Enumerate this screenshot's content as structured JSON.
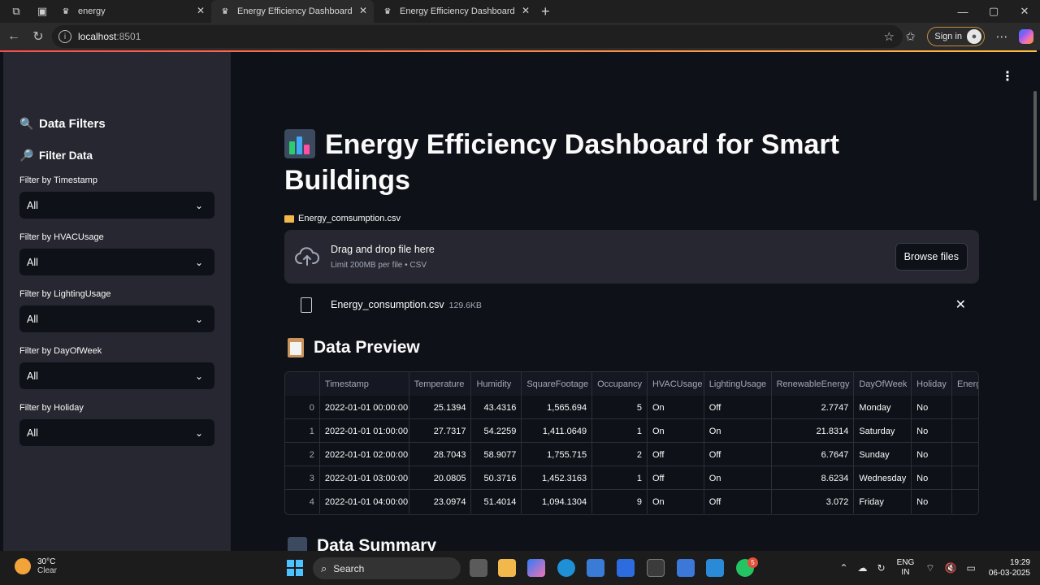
{
  "browser": {
    "tabs": [
      {
        "label": "energy",
        "active": false
      },
      {
        "label": "Energy Efficiency Dashboard",
        "active": true
      },
      {
        "label": "Energy Efficiency Dashboard",
        "active": false
      }
    ],
    "url_host": "localhost",
    "url_port": ":8501",
    "sign_in_label": "Sign in"
  },
  "sidebar": {
    "title": "Data Filters",
    "subtitle": "Filter Data",
    "filters": [
      {
        "label": "Filter by Timestamp",
        "value": "All"
      },
      {
        "label": "Filter by HVACUsage",
        "value": "All"
      },
      {
        "label": "Filter by LightingUsage",
        "value": "All"
      },
      {
        "label": "Filter by DayOfWeek",
        "value": "All"
      },
      {
        "label": "Filter by Holiday",
        "value": "All"
      }
    ]
  },
  "main": {
    "title": "Energy Efficiency Dashboard for Smart Buildings",
    "uploader_label": "Energy_comsumption.csv",
    "dropzone_title": "Drag and drop file here",
    "dropzone_limit": "Limit 200MB per file • CSV",
    "browse_label": "Browse files",
    "uploaded_file": {
      "name": "Energy_consumption.csv",
      "size": "129.6KB"
    },
    "preview_heading": "Data Preview",
    "summary_heading": "Data Summary",
    "table": {
      "columns": [
        "",
        "Timestamp",
        "Temperature",
        "Humidity",
        "SquareFootage",
        "Occupancy",
        "HVACUsage",
        "LightingUsage",
        "RenewableEnergy",
        "DayOfWeek",
        "Holiday",
        "Energ"
      ],
      "rows": [
        [
          "0",
          "2022-01-01 00:00:00",
          "25.1394",
          "43.4316",
          "1,565.694",
          "5",
          "On",
          "Off",
          "2.7747",
          "Monday",
          "No",
          ""
        ],
        [
          "1",
          "2022-01-01 01:00:00",
          "27.7317",
          "54.2259",
          "1,411.0649",
          "1",
          "On",
          "On",
          "21.8314",
          "Saturday",
          "No",
          ""
        ],
        [
          "2",
          "2022-01-01 02:00:00",
          "28.7043",
          "58.9077",
          "1,755.715",
          "2",
          "Off",
          "Off",
          "6.7647",
          "Sunday",
          "No",
          ""
        ],
        [
          "3",
          "2022-01-01 03:00:00",
          "20.0805",
          "50.3716",
          "1,452.3163",
          "1",
          "Off",
          "On",
          "8.6234",
          "Wednesday",
          "No",
          ""
        ],
        [
          "4",
          "2022-01-01 04:00:00",
          "23.0974",
          "51.4014",
          "1,094.1304",
          "9",
          "On",
          "Off",
          "3.072",
          "Friday",
          "No",
          ""
        ]
      ]
    }
  },
  "taskbar": {
    "temperature": "30°C",
    "weather": "Clear",
    "search_label": "Search",
    "whatsapp_badge": "5",
    "lang_line1": "ENG",
    "lang_line2": "IN",
    "time": "19:29",
    "date": "06-03-2025"
  }
}
